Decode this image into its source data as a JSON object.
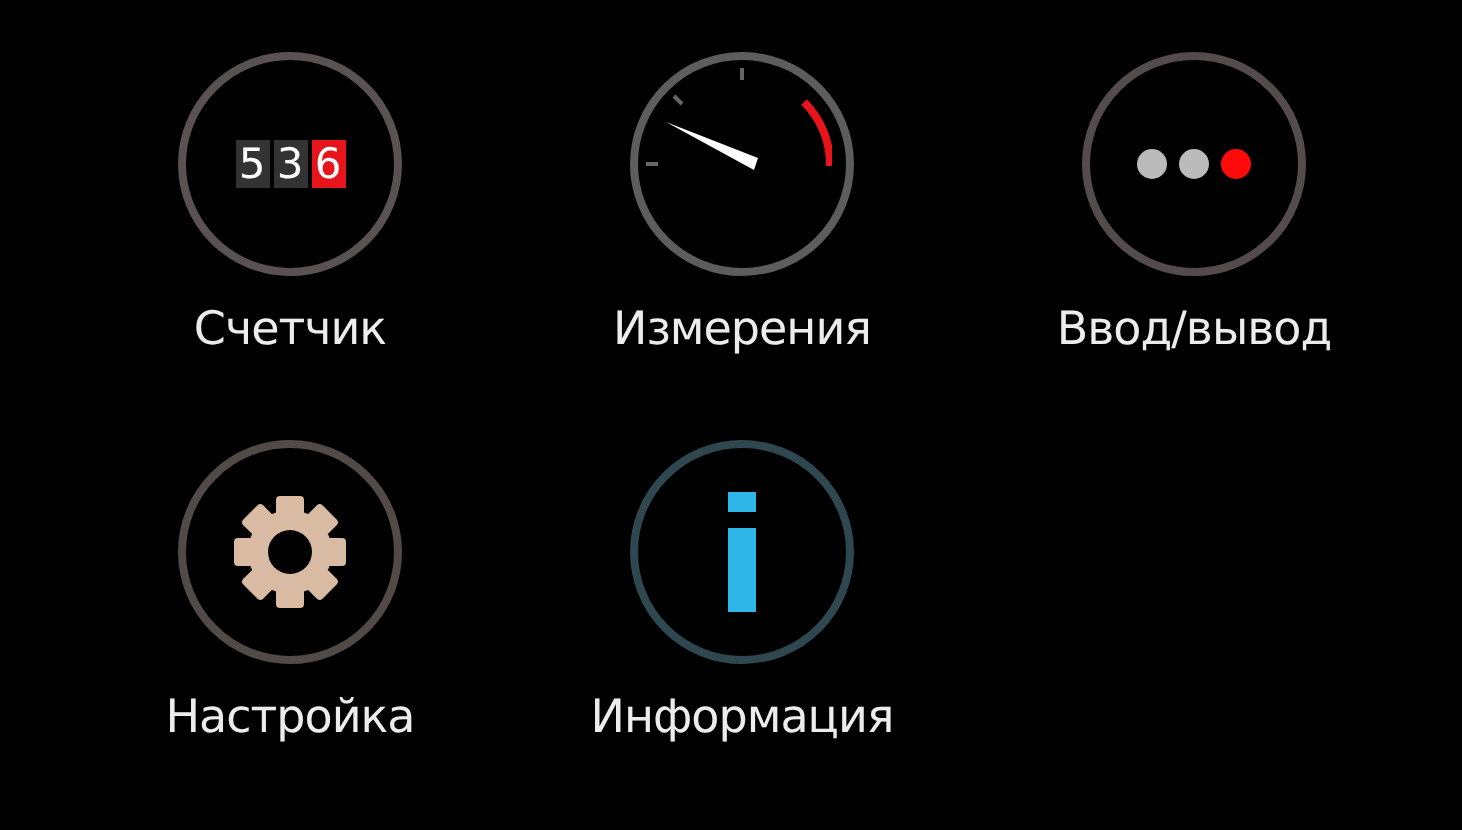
{
  "menu": [
    {
      "kind": "counter",
      "label": "Счетчик",
      "digits": [
        "5",
        "3",
        "6"
      ]
    },
    {
      "kind": "gauge",
      "label": "Измерения"
    },
    {
      "kind": "io",
      "label": "Ввод/вывод"
    },
    {
      "kind": "settings",
      "label": "Настройка"
    },
    {
      "kind": "info",
      "label": "Информация"
    }
  ]
}
